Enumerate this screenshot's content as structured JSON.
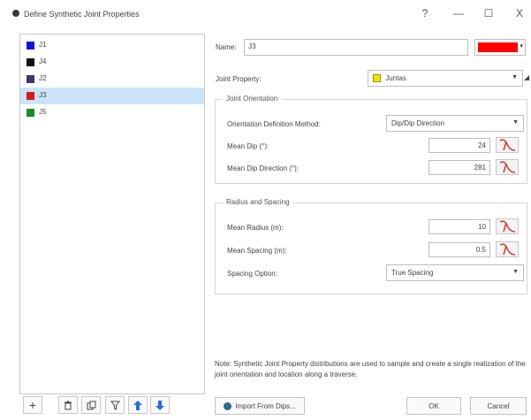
{
  "window": {
    "title": "Define Synthetic Joint Properties",
    "help": "?",
    "minimize": "—",
    "maximize": "☐",
    "close": "X"
  },
  "joints": [
    {
      "label": "J1",
      "color": "#1515d6"
    },
    {
      "label": "J4",
      "color": "#111111"
    },
    {
      "label": "J2",
      "color": "#3a3a6e"
    },
    {
      "label": "J3",
      "color": "#d41a1a"
    },
    {
      "label": "J5",
      "color": "#1f8a2a"
    }
  ],
  "selected_joint": "J3",
  "name": {
    "label": "Name:",
    "value": "J3",
    "color": "#ff0000"
  },
  "joint_property": {
    "label": "Joint Property:",
    "value": "Juntas",
    "swatch_color": "#f4e400"
  },
  "orientation": {
    "group_title": "Joint Orientation",
    "method_label": "Orientation Definition Method:",
    "method_value": "Dip/Dip Direction",
    "dip_label": "Mean Dip (°):",
    "dip_value": "24",
    "dipdir_label": "Mean Dip Direction (°):",
    "dipdir_value": "281"
  },
  "radius_spacing": {
    "group_title": "Radius and Spacing",
    "radius_label": "Mean Radius (m):",
    "radius_value": "10",
    "spacing_label": "Mean Spacing (m):",
    "spacing_value": "0.5",
    "option_label": "Spacing Option:",
    "option_value": "True Spacing"
  },
  "note": "Note: Synthetic Joint Property distributions are used to sample and create a single realization of the joint orientation and location along a traverse.",
  "buttons": {
    "import": "Import From Dips...",
    "ok": "OK",
    "cancel": "Cancel"
  },
  "toolbar": {
    "add": "+",
    "delete": "🗑",
    "copy": "⧉",
    "filter": "Y",
    "up": "🡅",
    "down": "🡇"
  },
  "colors": {
    "selection": "#cce4f7",
    "accent_blue": "#2b6fd6",
    "distribution_red": "#d8342a"
  }
}
